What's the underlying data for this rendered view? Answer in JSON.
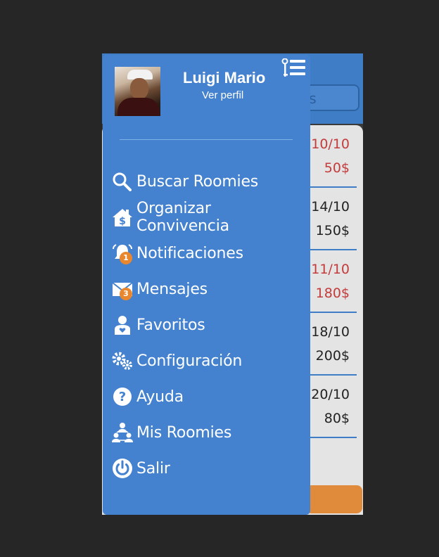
{
  "background_app": {
    "search_partial": "as",
    "rows": [
      {
        "date": "10/10",
        "price": "50$",
        "style": "red"
      },
      {
        "date": "14/10",
        "price": "150$",
        "style": "dark"
      },
      {
        "date": "11/10",
        "price": "180$",
        "style": "red"
      },
      {
        "date": "18/10",
        "price": "200$",
        "style": "dark"
      },
      {
        "date": "20/10",
        "price": "80$",
        "style": "dark"
      }
    ]
  },
  "drawer": {
    "user_name": "Luigi Mario",
    "view_profile": "Ver perfil",
    "menu": [
      {
        "label": "Buscar Roomies",
        "icon": "search-icon"
      },
      {
        "label": "Organizar Convivencia",
        "icon": "house-dollar-icon"
      },
      {
        "label": "Notificaciones",
        "icon": "bell-icon",
        "badge": "1"
      },
      {
        "label": "Mensajes",
        "icon": "envelope-icon",
        "badge": "3"
      },
      {
        "label": "Favoritos",
        "icon": "person-heart-icon"
      },
      {
        "label": "Configuración",
        "icon": "gears-icon"
      },
      {
        "label": "Ayuda",
        "icon": "help-icon"
      },
      {
        "label": "Mis Roomies",
        "icon": "group-icon"
      },
      {
        "label": "Salir",
        "icon": "power-icon"
      }
    ]
  },
  "colors": {
    "drawer_bg": "#4482cf",
    "badge": "#e8872e",
    "accent_red": "#c33b3b",
    "footer_button": "#e08a3c"
  }
}
